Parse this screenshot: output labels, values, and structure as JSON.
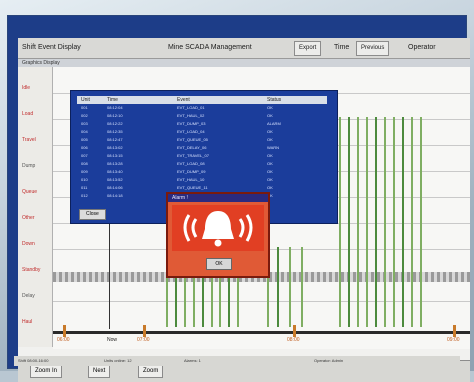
{
  "window": {
    "title": "Shift Event Display",
    "app_name": "Mine SCADA Management",
    "btn_export": "Export",
    "btn_prev": "Previous",
    "btn_next": "Next",
    "time_label": "Time",
    "operator_label": "Operator"
  },
  "subbar": {
    "text": "Graphics Display"
  },
  "left_labels": [
    "Idle",
    "Load",
    "Travel",
    "Dump",
    "Queue",
    "Other",
    "Down",
    "Standby",
    "Delay",
    "Haul"
  ],
  "event_dialog": {
    "header": [
      "Unit",
      "Time",
      "Event",
      "Status"
    ],
    "rows": [
      [
        "001",
        "08:12:04",
        "EVT_LOAD_01",
        "OK"
      ],
      [
        "002",
        "08:12:10",
        "EVT_HAUL_02",
        "OK"
      ],
      [
        "003",
        "08:12:22",
        "EVT_DUMP_03",
        "ALARM"
      ],
      [
        "004",
        "08:12:35",
        "EVT_LOAD_04",
        "OK"
      ],
      [
        "005",
        "08:12:47",
        "EVT_QUEUE_05",
        "OK"
      ],
      [
        "006",
        "08:13:02",
        "EVT_DELAY_06",
        "WARN"
      ],
      [
        "007",
        "08:13:15",
        "EVT_TRAVEL_07",
        "OK"
      ],
      [
        "008",
        "08:13:28",
        "EVT_LOAD_08",
        "OK"
      ],
      [
        "009",
        "08:13:40",
        "EVT_DUMP_09",
        "OK"
      ],
      [
        "010",
        "08:13:52",
        "EVT_HAUL_10",
        "OK"
      ],
      [
        "011",
        "08:14:06",
        "EVT_QUEUE_11",
        "OK"
      ],
      [
        "012",
        "08:14:18",
        "EVT_LOAD_12",
        "OK"
      ]
    ],
    "close_btn": "Close"
  },
  "alarm": {
    "title": "Alarm !",
    "ack_btn": "OK"
  },
  "timeline": {
    "ticks": [
      "06:00",
      "07:00",
      "08:00",
      "09:00"
    ],
    "marker": "Now"
  },
  "statusbar": {
    "btn_1": "Zoom In",
    "btn_2": "Next",
    "btn_3": "Zoom",
    "info_1": "Shift 08:00-16:00",
    "info_2": "Units online: 12",
    "info_3": "Alarms: 1",
    "info_4": "Operator: Admin"
  },
  "colors": {
    "dialog_bg": "#1b3d9b",
    "alarm_bg": "#e05a36",
    "chart_line": "#7fae62",
    "tick": "#c87a2a"
  }
}
